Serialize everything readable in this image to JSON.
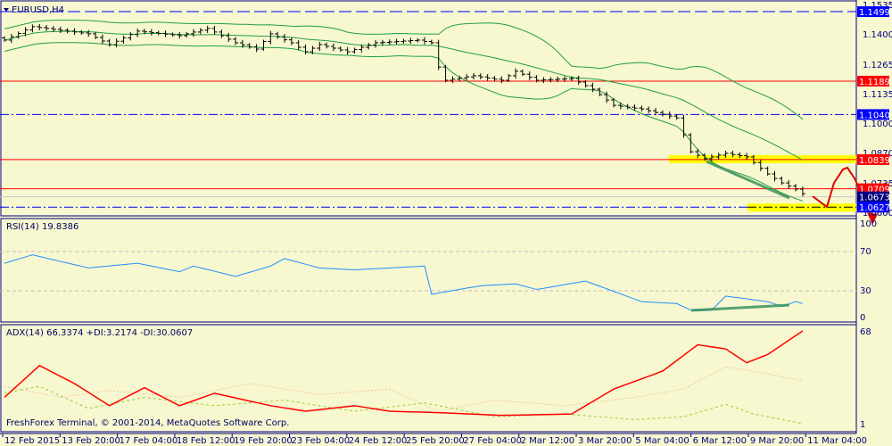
{
  "window": {
    "symbol_title": "EURUSD,H4",
    "copyright": "FreshForex Terminal, © 2001-2014, MetaQuotes Software Corp."
  },
  "colors": {
    "background": "#f7f7d0",
    "frame": "#000080",
    "bars": "#000000",
    "bands": "#20a040",
    "rsi": "#1e90ff",
    "adx": "#ff0000",
    "plus_di": "#f0c8a0",
    "minus_di": "#9acd32",
    "level_red": "#ff0000",
    "level_blue": "#0000ff",
    "zone": "#ffff00",
    "trend": "#2e8b57"
  },
  "price_axis": {
    "ticks": [
      "1.1535",
      "1.1400",
      "1.1265",
      "1.1135",
      "1.1000",
      "1.0870",
      "1.0735",
      "1.0600"
    ]
  },
  "price_tags": [
    {
      "label": "1.1499",
      "color": "#0000ff"
    },
    {
      "label": "1.1189",
      "color": "#ff0000"
    },
    {
      "label": "1.1040",
      "color": "#0000ff"
    },
    {
      "label": "1.0839",
      "color": "#ff0000"
    },
    {
      "label": "1.0709",
      "color": "#ff0000"
    },
    {
      "label": "1.0673",
      "color": "#000080"
    },
    {
      "label": "1.0627",
      "color": "#0000ff"
    }
  ],
  "time_axis": [
    "12 Feb 2015",
    "13 Feb 20:00",
    "17 Feb 04:00",
    "18 Feb 12:00",
    "19 Feb 20:00",
    "23 Feb 04:00",
    "24 Feb 12:00",
    "25 Feb 20:00",
    "27 Feb 04:00",
    "2 Mar 12:00",
    "3 Mar 20:00",
    "5 Mar 04:00",
    "6 Mar 12:00",
    "9 Mar 20:00",
    "11 Mar 04:00"
  ],
  "rsi": {
    "title": "RSI(14) 19.8386",
    "levels": [
      "100",
      "70",
      "30",
      "0"
    ]
  },
  "adx": {
    "title": "ADX(14) 66.3374 +DI:3.2174 -DI:30.0607",
    "levels": [
      "68",
      "1"
    ]
  },
  "chart_data": {
    "type": "line",
    "title": "EURUSD,H4",
    "ylim": [
      1.06,
      1.1535
    ],
    "bars_count": 115,
    "close_keypoints": [
      [
        0,
        1.1372
      ],
      [
        4,
        1.1432
      ],
      [
        12,
        1.14
      ],
      [
        15,
        1.1352
      ],
      [
        19,
        1.1412
      ],
      [
        25,
        1.1392
      ],
      [
        29,
        1.1424
      ],
      [
        33,
        1.136
      ],
      [
        36,
        1.1332
      ],
      [
        38,
        1.14
      ],
      [
        41,
        1.136
      ],
      [
        43,
        1.132
      ],
      [
        45,
        1.1352
      ],
      [
        49,
        1.132
      ],
      [
        53,
        1.136
      ],
      [
        59,
        1.1372
      ],
      [
        61,
        1.136
      ],
      [
        62,
        1.1252
      ],
      [
        63,
        1.1193
      ],
      [
        67,
        1.1213
      ],
      [
        71,
        1.1193
      ],
      [
        73,
        1.1233
      ],
      [
        76,
        1.1193
      ],
      [
        81,
        1.1201
      ],
      [
        84,
        1.1153
      ],
      [
        87,
        1.1081
      ],
      [
        91,
        1.1065
      ],
      [
        96,
        1.1025
      ],
      [
        98,
        1.0874
      ],
      [
        100,
        1.0843
      ],
      [
        103,
        1.0867
      ],
      [
        106,
        1.0851
      ],
      [
        109,
        1.0775
      ],
      [
        111,
        1.0735
      ],
      [
        113,
        1.0707
      ],
      [
        114,
        1.0687
      ]
    ],
    "levels": [
      1.1499,
      1.1189,
      1.104,
      1.0839,
      1.0709,
      1.0673,
      1.0627
    ],
    "rsi_keypoints": [
      [
        0,
        57
      ],
      [
        4,
        66
      ],
      [
        12,
        52
      ],
      [
        19,
        57
      ],
      [
        25,
        48
      ],
      [
        27,
        54
      ],
      [
        33,
        43
      ],
      [
        38,
        54
      ],
      [
        40,
        62
      ],
      [
        45,
        52
      ],
      [
        50,
        50
      ],
      [
        60,
        54
      ],
      [
        61,
        24
      ],
      [
        68,
        33
      ],
      [
        73,
        35
      ],
      [
        76,
        29
      ],
      [
        83,
        38
      ],
      [
        91,
        16
      ],
      [
        96,
        14
      ],
      [
        98,
        7
      ],
      [
        101,
        7
      ],
      [
        103,
        22
      ],
      [
        109,
        16
      ],
      [
        111,
        11
      ],
      [
        113,
        16
      ],
      [
        114,
        14
      ]
    ],
    "adx_keypoints": [
      [
        0,
        20
      ],
      [
        5,
        43
      ],
      [
        10,
        30
      ],
      [
        15,
        14
      ],
      [
        20,
        27
      ],
      [
        25,
        14
      ],
      [
        30,
        23
      ],
      [
        38,
        14
      ],
      [
        43,
        10
      ],
      [
        50,
        14
      ],
      [
        55,
        10
      ],
      [
        62,
        9
      ],
      [
        71,
        7
      ],
      [
        81,
        8
      ],
      [
        87,
        26
      ],
      [
        94,
        39
      ],
      [
        99,
        58
      ],
      [
        103,
        55
      ],
      [
        106,
        45
      ],
      [
        109,
        51
      ],
      [
        114,
        68
      ]
    ],
    "plus_di_keypoints": [
      [
        0,
        28
      ],
      [
        8,
        20
      ],
      [
        15,
        25
      ],
      [
        25,
        20
      ],
      [
        35,
        30
      ],
      [
        45,
        22
      ],
      [
        55,
        26
      ],
      [
        62,
        10
      ],
      [
        70,
        18
      ],
      [
        80,
        14
      ],
      [
        90,
        20
      ],
      [
        97,
        26
      ],
      [
        103,
        42
      ],
      [
        108,
        38
      ],
      [
        114,
        32
      ]
    ],
    "minus_di_keypoints": [
      [
        0,
        23
      ],
      [
        5,
        28
      ],
      [
        12,
        12
      ],
      [
        20,
        20
      ],
      [
        30,
        14
      ],
      [
        40,
        18
      ],
      [
        50,
        10
      ],
      [
        60,
        16
      ],
      [
        70,
        6
      ],
      [
        80,
        8
      ],
      [
        90,
        4
      ],
      [
        97,
        6
      ],
      [
        103,
        15
      ],
      [
        107,
        8
      ],
      [
        114,
        1
      ]
    ]
  }
}
